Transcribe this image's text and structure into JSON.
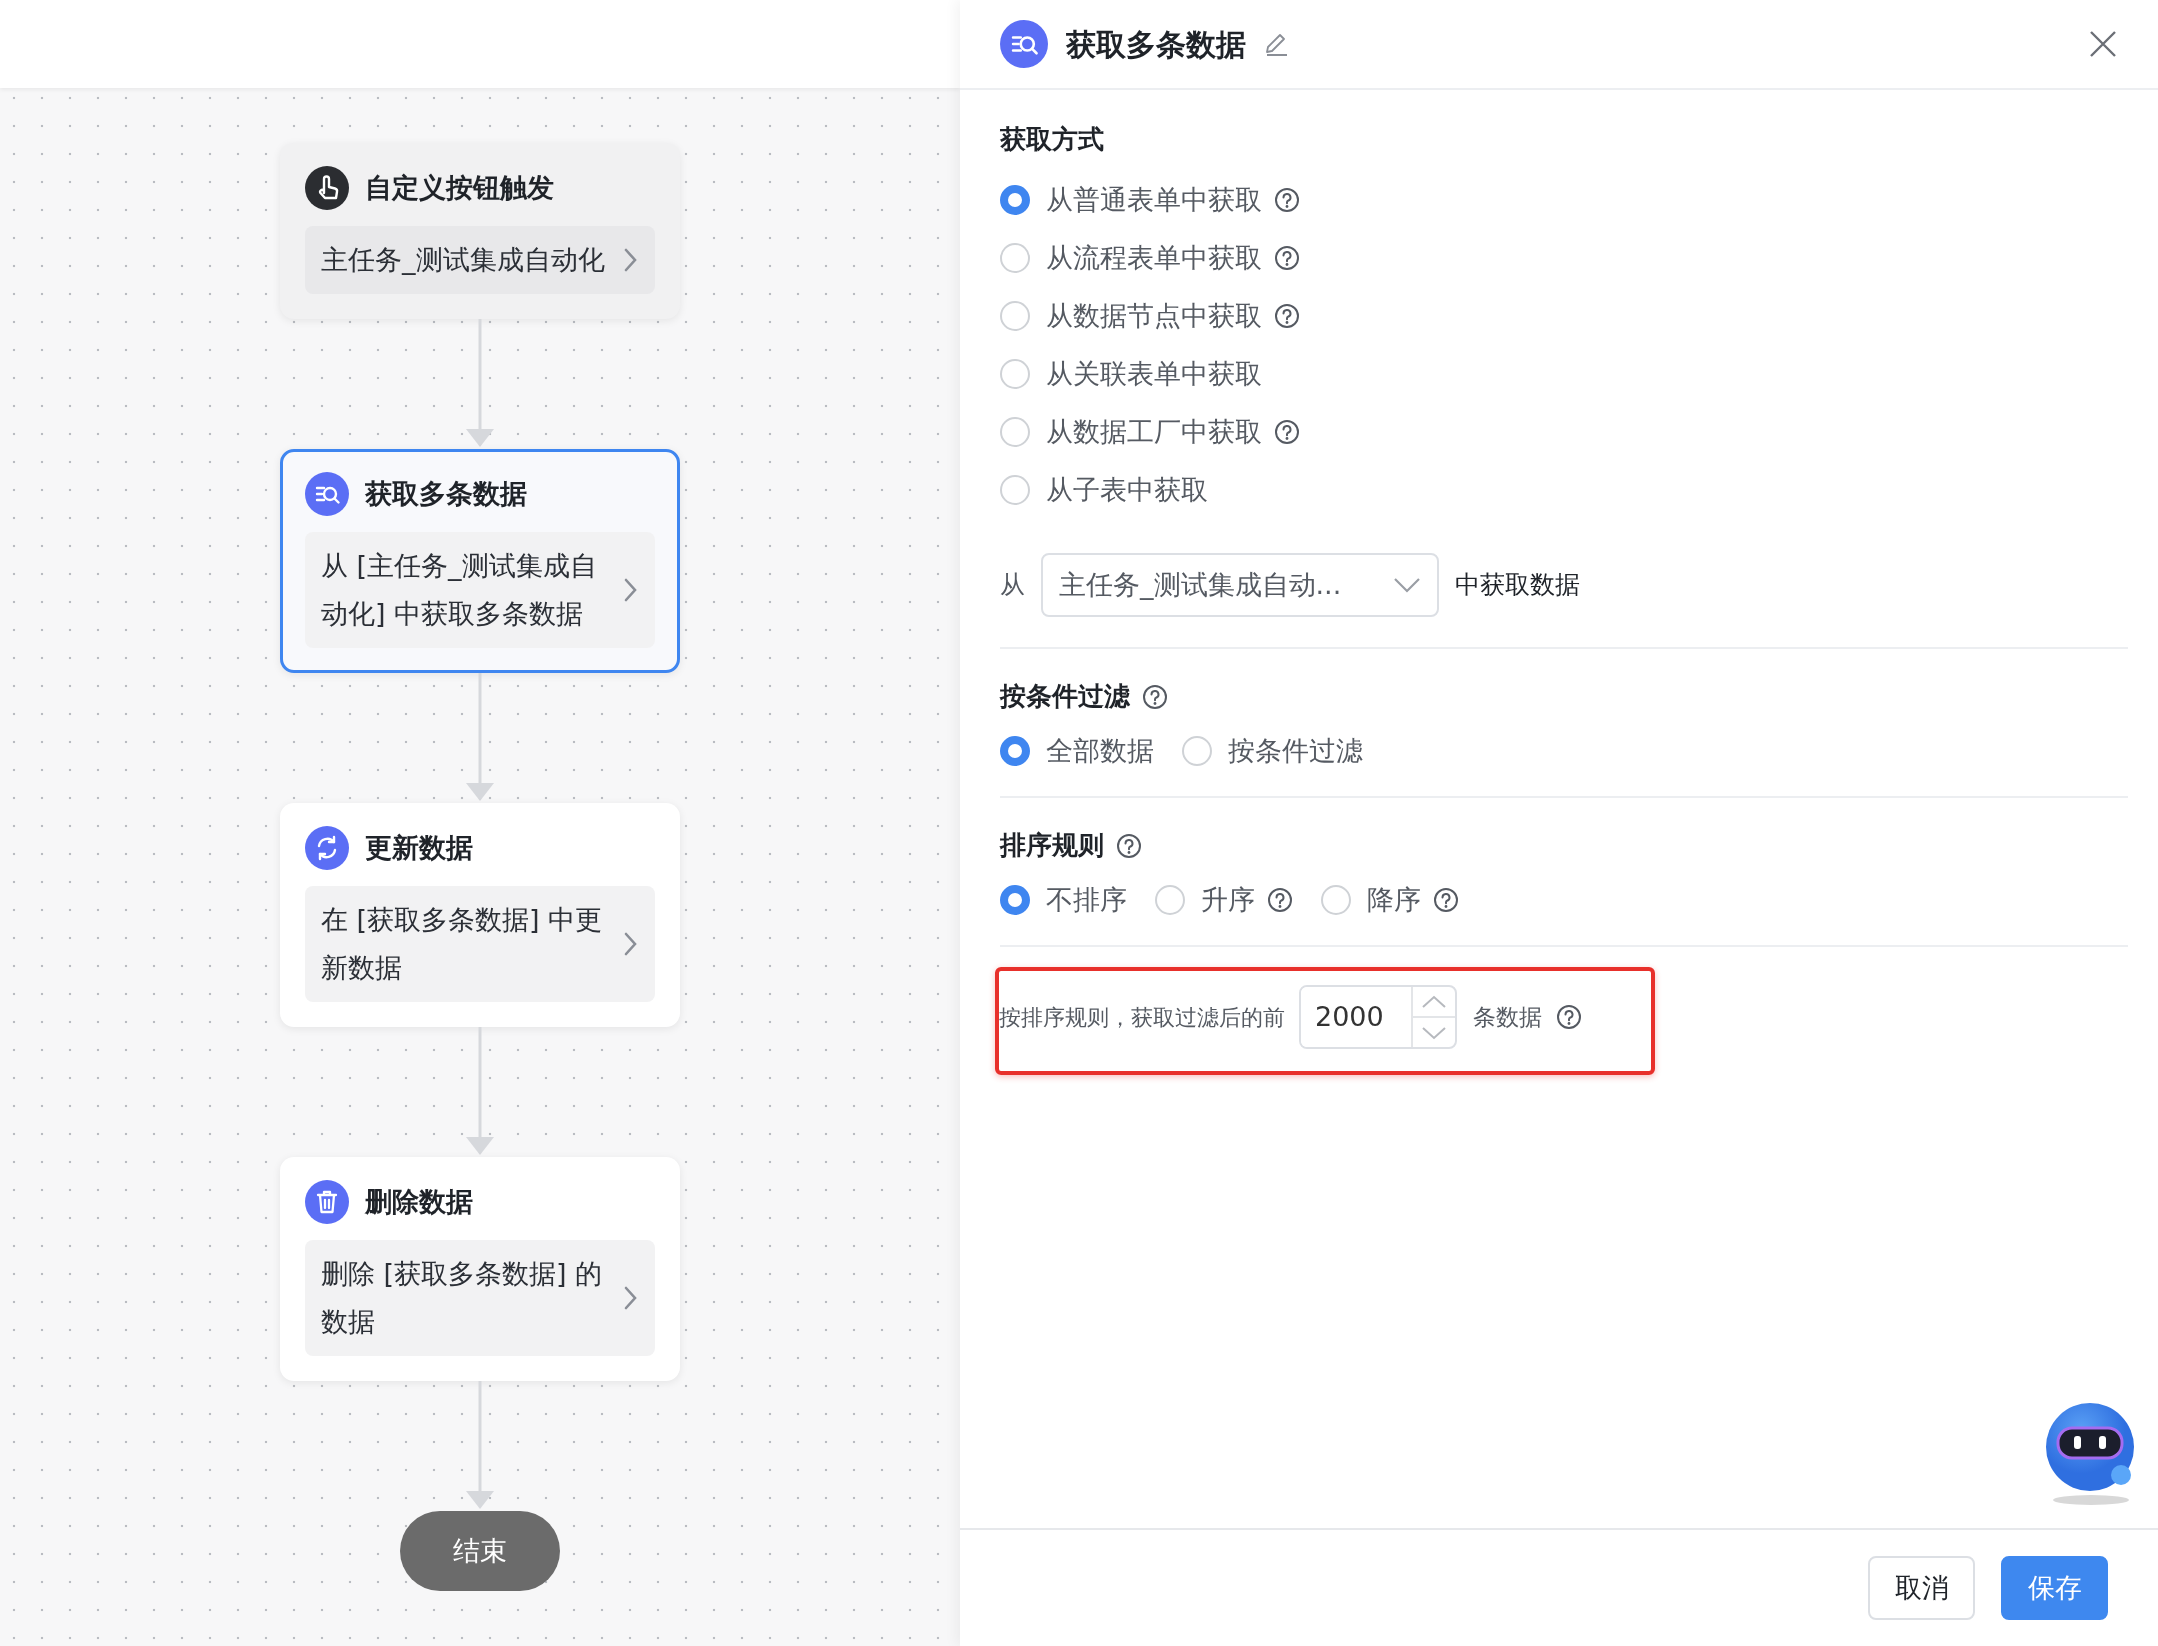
{
  "canvas": {
    "nodes": [
      {
        "kind": "trigger",
        "title": "自定义按钮触发",
        "summary": "主任务_测试集成自动化",
        "selected": false
      },
      {
        "kind": "query",
        "title": "获取多条数据",
        "summary": "从 [主任务_测试集成自动化] 中获取多条数据",
        "selected": true
      },
      {
        "kind": "update",
        "title": "更新数据",
        "summary": "在 [获取多条数据] 中更新数据",
        "selected": false
      },
      {
        "kind": "delete",
        "title": "删除数据",
        "summary": "删除 [获取多条数据] 的数据",
        "selected": false
      }
    ],
    "end_node": {
      "label": "结束"
    }
  },
  "panel": {
    "title": "获取多条数据",
    "fetch_method": {
      "title": "获取方式",
      "options": [
        {
          "label": "从普通表单中获取",
          "selected": true,
          "help": true
        },
        {
          "label": "从流程表单中获取",
          "selected": false,
          "help": true
        },
        {
          "label": "从数据节点中获取",
          "selected": false,
          "help": true
        },
        {
          "label": "从关联表单中获取",
          "selected": false,
          "help": false
        },
        {
          "label": "从数据工厂中获取",
          "selected": false,
          "help": true
        },
        {
          "label": "从子表中获取",
          "selected": false,
          "help": false
        }
      ]
    },
    "source": {
      "prefix": "从",
      "select_value": "主任务_测试集成自动...",
      "suffix": "中获取数据"
    },
    "filter": {
      "title": "按条件过滤",
      "help": true,
      "options": [
        {
          "label": "全部数据",
          "selected": true,
          "help": false
        },
        {
          "label": "按条件过滤",
          "selected": false,
          "help": false
        }
      ]
    },
    "sort": {
      "title": "排序规则",
      "help": true,
      "options": [
        {
          "label": "不排序",
          "selected": true,
          "help": false
        },
        {
          "label": "升序",
          "selected": false,
          "help": true
        },
        {
          "label": "降序",
          "selected": false,
          "help": true
        }
      ]
    },
    "limit": {
      "prefix": "按排序规则，获取过滤后的前",
      "value": "2000",
      "suffix": "条数据",
      "help": true,
      "highlighted": true
    },
    "buttons": [
      {
        "label": "取消",
        "kind": "default"
      },
      {
        "label": "保存",
        "kind": "primary"
      }
    ]
  }
}
